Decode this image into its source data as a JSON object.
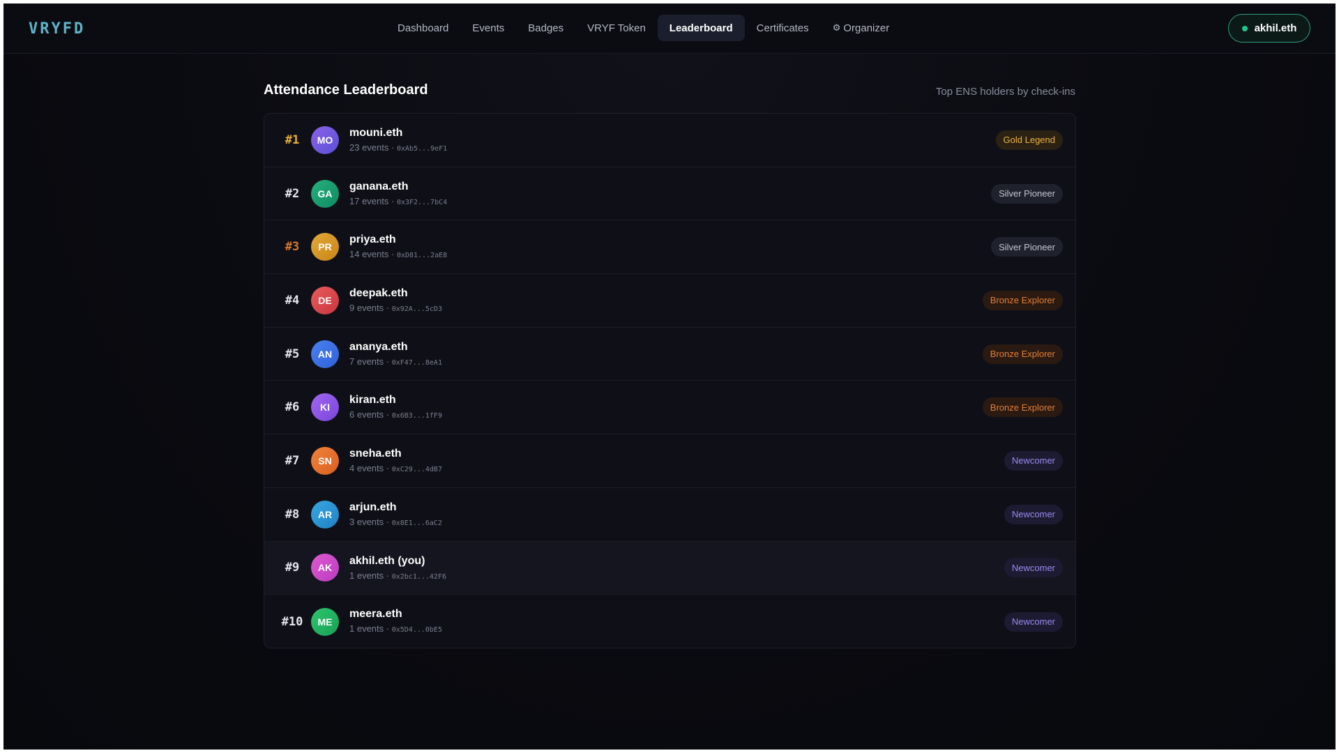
{
  "app": {
    "logo": "VRYFD"
  },
  "nav": {
    "links": [
      {
        "label": "Dashboard"
      },
      {
        "label": "Events"
      },
      {
        "label": "Badges"
      },
      {
        "label": "VRYF Token"
      },
      {
        "label": "Leaderboard",
        "active": true
      },
      {
        "label": "Certificates"
      },
      {
        "label": "Organizer",
        "icon": "gear-icon"
      }
    ],
    "wallet": "akhil.eth",
    "wallet_status_color": "#22c58b"
  },
  "page": {
    "title": "Attendance Leaderboard",
    "subtitle": "Top ENS holders by check-ins"
  },
  "leaderboard": [
    {
      "rank": "#1",
      "initials": "MO",
      "name": "mouni.eth",
      "events": "23 events",
      "address": "0xAb5...9eF1",
      "badge": "Gold Legend",
      "tier": "gold",
      "rank_style": "gold",
      "avatar_colors": [
        "#8a63e8",
        "#5b4fd6"
      ]
    },
    {
      "rank": "#2",
      "initials": "GA",
      "name": "ganana.eth",
      "events": "17 events",
      "address": "0x3F2...7bC4",
      "badge": "Silver Pioneer",
      "tier": "silver",
      "rank_style": "silver",
      "avatar_colors": [
        "#25b07e",
        "#0f8a62"
      ]
    },
    {
      "rank": "#3",
      "initials": "PR",
      "name": "priya.eth",
      "events": "14 events",
      "address": "0xD81...2aE8",
      "badge": "Silver Pioneer",
      "tier": "silver",
      "rank_style": "bronze",
      "avatar_colors": [
        "#e2a93a",
        "#c98514"
      ]
    },
    {
      "rank": "#4",
      "initials": "DE",
      "name": "deepak.eth",
      "events": "9 events",
      "address": "0x92A...5cD3",
      "badge": "Bronze Explorer",
      "tier": "bronze",
      "rank_style": "plain",
      "avatar_colors": [
        "#ea5b5b",
        "#c7363f"
      ]
    },
    {
      "rank": "#5",
      "initials": "AN",
      "name": "ananya.eth",
      "events": "7 events",
      "address": "0xF47...8eA1",
      "badge": "Bronze Explorer",
      "tier": "bronze",
      "rank_style": "plain",
      "avatar_colors": [
        "#4a82f0",
        "#2f5fd8"
      ]
    },
    {
      "rank": "#6",
      "initials": "KI",
      "name": "kiran.eth",
      "events": "6 events",
      "address": "0x6B3...1fF9",
      "badge": "Bronze Explorer",
      "tier": "bronze",
      "rank_style": "plain",
      "avatar_colors": [
        "#a067ef",
        "#7b45dc"
      ]
    },
    {
      "rank": "#7",
      "initials": "SN",
      "name": "sneha.eth",
      "events": "4 events",
      "address": "0xC29...4dB7",
      "badge": "Newcomer",
      "tier": "newcomer",
      "rank_style": "plain",
      "avatar_colors": [
        "#f0843b",
        "#d95f1f"
      ]
    },
    {
      "rank": "#8",
      "initials": "AR",
      "name": "arjun.eth",
      "events": "3 events",
      "address": "0x8E1...6aC2",
      "badge": "Newcomer",
      "tier": "newcomer",
      "rank_style": "plain",
      "avatar_colors": [
        "#3aa6e2",
        "#1f82c4"
      ]
    },
    {
      "rank": "#9",
      "initials": "AK",
      "name": "akhil.eth (you)",
      "events": "1 events",
      "address": "0x2bc1...42F6",
      "badge": "Newcomer",
      "tier": "newcomer",
      "rank_style": "plain",
      "avatar_colors": [
        "#e05ad0",
        "#b83cc0"
      ],
      "is_you": true
    },
    {
      "rank": "#10",
      "initials": "ME",
      "name": "meera.eth",
      "events": "1 events",
      "address": "0x5D4...0bE5",
      "badge": "Newcomer",
      "tier": "newcomer",
      "rank_style": "plain",
      "avatar_colors": [
        "#2fc46e",
        "#17a153"
      ]
    }
  ]
}
